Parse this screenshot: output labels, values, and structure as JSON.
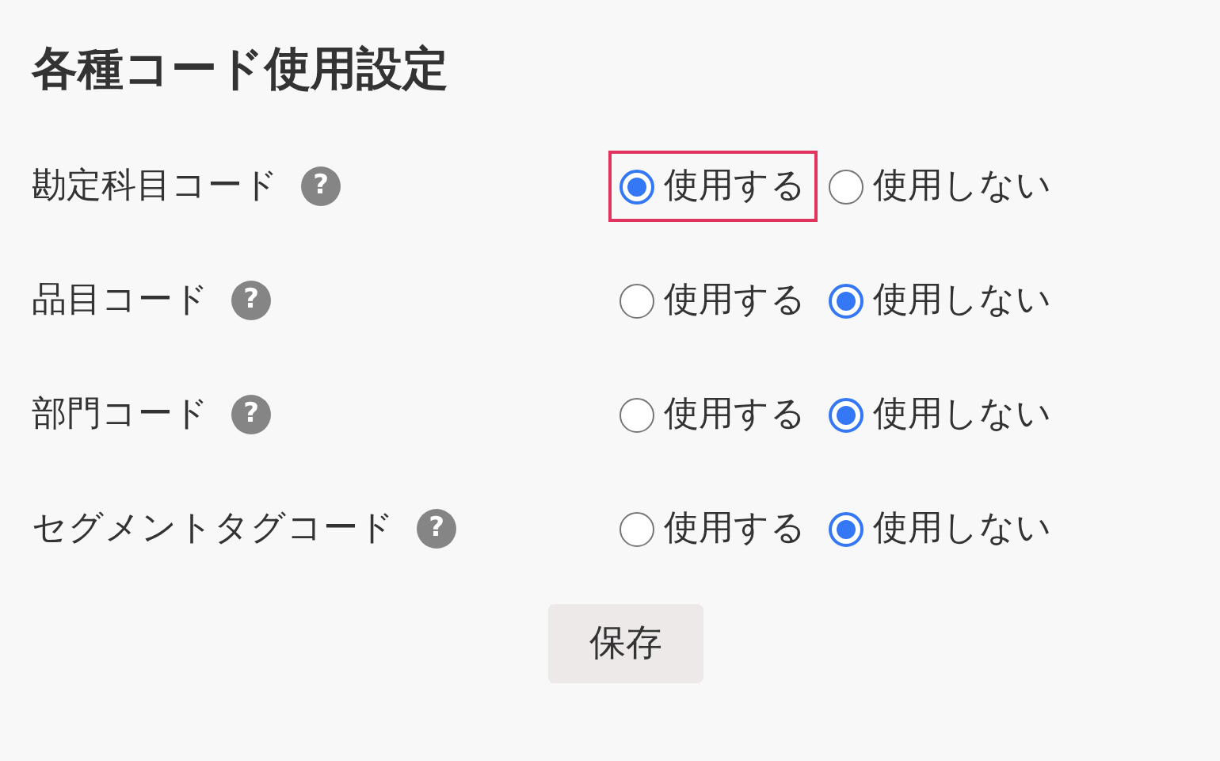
{
  "title": "各種コード使用設定",
  "rows": [
    {
      "label": "勘定科目コード",
      "help": "?",
      "options": [
        {
          "label": "使用する",
          "selected": true,
          "highlighted": true
        },
        {
          "label": "使用しない",
          "selected": false,
          "highlighted": false
        }
      ]
    },
    {
      "label": "品目コード",
      "help": "?",
      "options": [
        {
          "label": "使用する",
          "selected": false,
          "highlighted": false
        },
        {
          "label": "使用しない",
          "selected": true,
          "highlighted": false
        }
      ]
    },
    {
      "label": "部門コード",
      "help": "?",
      "options": [
        {
          "label": "使用する",
          "selected": false,
          "highlighted": false
        },
        {
          "label": "使用しない",
          "selected": true,
          "highlighted": false
        }
      ]
    },
    {
      "label": "セグメントタグコード",
      "help": "?",
      "options": [
        {
          "label": "使用する",
          "selected": false,
          "highlighted": false
        },
        {
          "label": "使用しない",
          "selected": true,
          "highlighted": false
        }
      ]
    }
  ],
  "save_button": "保存"
}
